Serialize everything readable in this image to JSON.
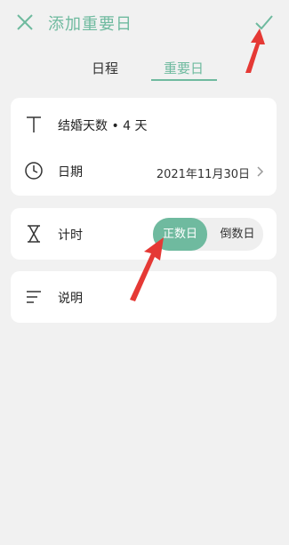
{
  "header": {
    "title": "添加重要日",
    "close_icon": "close-icon",
    "check_icon": "check-icon",
    "accent": "#6fba9f"
  },
  "tabs": [
    {
      "label": "日程",
      "selected": false
    },
    {
      "label": "重要日",
      "selected": true
    }
  ],
  "card1": {
    "title_row": {
      "icon": "text-t-icon",
      "label": "结婚天数 • 4 天"
    },
    "date_row": {
      "icon": "clock-icon",
      "label": "日期",
      "value": "2021年11月30日",
      "chevron": "chevron-right-icon"
    }
  },
  "card2": {
    "timer_row": {
      "icon": "hourglass-icon",
      "label": "计时",
      "options": [
        "正数日",
        "倒数日"
      ],
      "selected": "正数日"
    }
  },
  "card3": {
    "note_row": {
      "icon": "lines-icon",
      "label": "说明"
    }
  },
  "annotation_color": "#e53935"
}
